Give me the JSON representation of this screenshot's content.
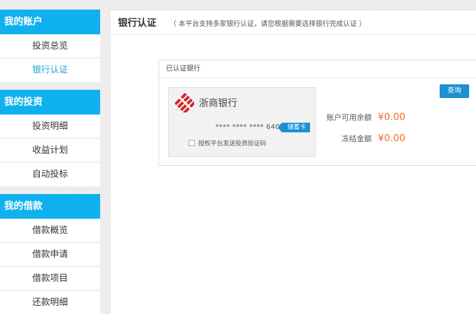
{
  "sidebar": {
    "sections": [
      {
        "title": "我的账户",
        "items": [
          "投资总览",
          "银行认证"
        ]
      },
      {
        "title": "我的投资",
        "items": [
          "投资明细",
          "收益计划",
          "自动投标"
        ]
      },
      {
        "title": "我的借款",
        "items": [
          "借款概览",
          "借款申请",
          "借款项目",
          "还款明细"
        ]
      }
    ],
    "active_item": "银行认证"
  },
  "main": {
    "title": "银行认证",
    "subtitle": "（ 本平台支持多家银行认证，请您根据需要选择银行完成认证 ）",
    "verified_box": {
      "header": "已认证银行",
      "card": {
        "bank_name": "浙商银行",
        "card_number": "**** **** **** 6401",
        "card_type": "储蓄卡",
        "authorize_label": "授权平台发送投资验证码",
        "authorize_checked": false
      },
      "query_button": "查询",
      "available_balance_label": "账户可用余额",
      "available_balance": "¥0.00",
      "frozen_label": "冻结金额",
      "frozen_amount": "¥0.00"
    }
  },
  "colors": {
    "sidebar_header": "#0fb0ee",
    "active_link": "#1ea0dc",
    "button": "#1b90d2",
    "amount": "#f06a1e",
    "bank_logo": "#d6262b"
  },
  "icons": {
    "bank_logo": "czbank-logo-icon",
    "checkbox": "checkbox-icon"
  }
}
